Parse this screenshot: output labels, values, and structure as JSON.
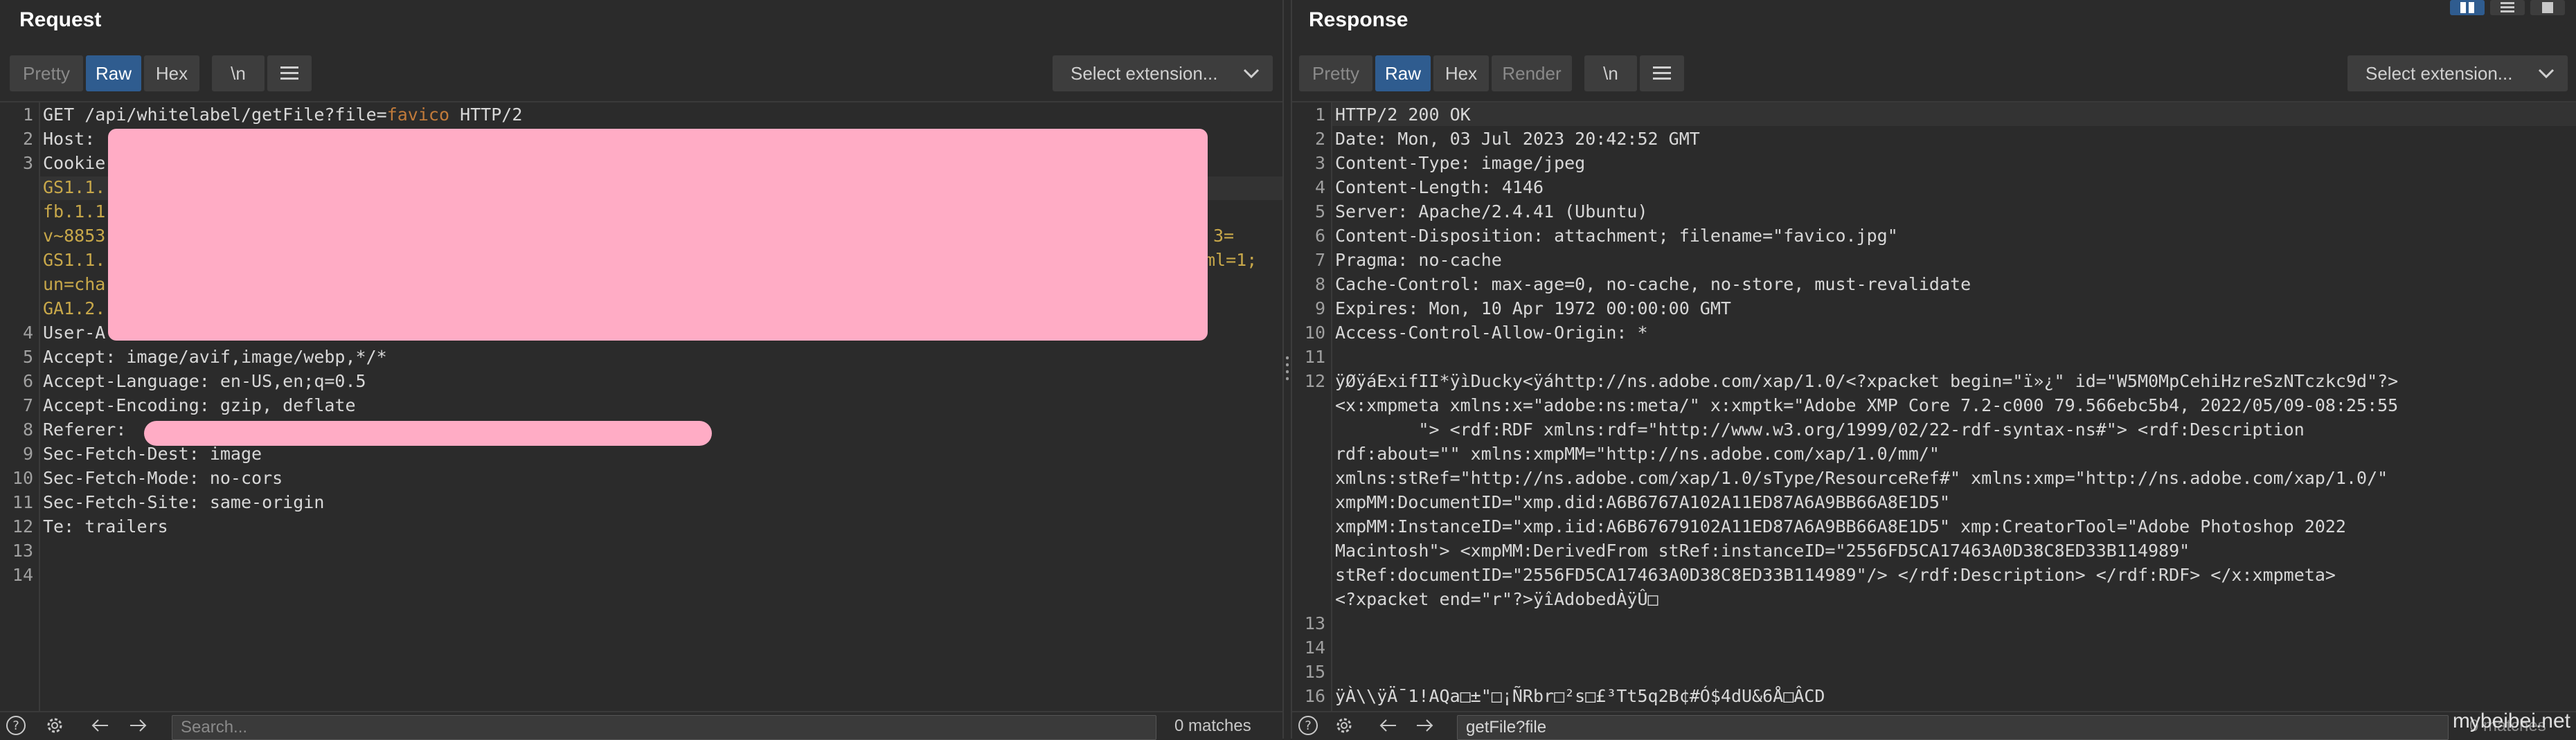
{
  "request": {
    "title": "Request",
    "view_tabs": [
      "Pretty",
      "Raw",
      "Hex",
      "\\n"
    ],
    "menu_icon": "hamburger-icon",
    "select_extension": "Select extension...",
    "lines": {
      "l1_method": "GET /api/whitelabel/getFile?file=",
      "l1_param": "favico",
      "l1_proto": " HTTP/2",
      "l2": "Host: ",
      "l3": "Cookie",
      "l3a": "GS1.1.",
      "l3b": "fb.1.1",
      "l3c": "v~8853",
      "l3c_tail": "3=",
      "l3d": "GS1.1.",
      "l3d_tail": "ml=1;",
      "l3e": "un=cha",
      "l3f": "GA1.2.",
      "l4": "User-A",
      "l5": "Accept: image/avif,image/webp,*/*",
      "l6": "Accept-Language: en-US,en;q=0.5",
      "l7": "Accept-Encoding: gzip, deflate",
      "l8": "Referer: ",
      "l9": "Sec-Fetch-Dest: image",
      "l10": "Sec-Fetch-Mode: no-cors",
      "l11": "Sec-Fetch-Site: same-origin",
      "l12": "Te: trailers",
      "l13": "",
      "l14": ""
    },
    "line_numbers": [
      "1",
      "2",
      "3",
      "4",
      "5",
      "6",
      "7",
      "8",
      "9",
      "10",
      "11",
      "12",
      "13",
      "14"
    ],
    "search_placeholder": "Search...",
    "matches": "0 matches"
  },
  "response": {
    "title": "Response",
    "view_tabs": [
      "Pretty",
      "Raw",
      "Hex",
      "Render",
      "\\n"
    ],
    "menu_icon": "hamburger-icon",
    "select_extension": "Select extension...",
    "lines": {
      "l1": "HTTP/2 200 OK",
      "l2": "Date: Mon, 03 Jul 2023 20:42:52 GMT",
      "l3": "Content-Type: image/jpeg",
      "l4": "Content-Length: 4146",
      "l5": "Server: Apache/2.4.41 (Ubuntu)",
      "l6": "Content-Disposition: attachment; filename=\"favico.jpg\"",
      "l7": "Pragma: no-cache",
      "l8": "Cache-Control: max-age=0, no-cache, no-store, must-revalidate",
      "l9": "Expires: Mon, 10 Apr 1972 00:00:00 GMT",
      "l10": "Access-Control-Allow-Origin: *",
      "l11": "",
      "l12a": "ÿØÿáExifII*ÿìDucky<ÿáhttp://ns.adobe.com/xap/1.0/<?xpacket begin=\"ï»¿\" id=\"W5M0MpCehiHzreSzNTczkc9d\"?>",
      "l12b": "<x:xmpmeta xmlns:x=\"adobe:ns:meta/\" x:xmptk=\"Adobe XMP Core 7.2-c000 79.566ebc5b4, 2022/05/09-08:25:55",
      "l12c": "        \"> <rdf:RDF xmlns:rdf=\"http://www.w3.org/1999/02/22-rdf-syntax-ns#\"> <rdf:Description",
      "l12d": "rdf:about=\"\" xmlns:xmpMM=\"http://ns.adobe.com/xap/1.0/mm/\"",
      "l12e": "xmlns:stRef=\"http://ns.adobe.com/xap/1.0/sType/ResourceRef#\" xmlns:xmp=\"http://ns.adobe.com/xap/1.0/\"",
      "l12f": "xmpMM:DocumentID=\"xmp.did:A6B6767A102A11ED87A6A9BB66A8E1D5\"",
      "l12g": "xmpMM:InstanceID=\"xmp.iid:A6B67679102A11ED87A6A9BB66A8E1D5\" xmp:CreatorTool=\"Adobe Photoshop 2022",
      "l12h": "Macintosh\"> <xmpMM:DerivedFrom stRef:instanceID=\"2556FD5CA17463A0D38C8ED33B114989\"",
      "l12i": "stRef:documentID=\"2556FD5CA17463A0D38C8ED33B114989\"/> </rdf:Description> </rdf:RDF> </x:xmpmeta>",
      "l12j": "<?xpacket end=\"r\"?>ÿîAdobedÀÿÛ□",
      "l13": "",
      "l14": "",
      "l15": "",
      "l16": "ÿÀ\\\\ÿÄ¯1!AQa□±\"□¡ÑRbr□²s□£³Tt5q2B¢#Ó$4dU&6Å□ÂCD"
    },
    "line_numbers": [
      "1",
      "2",
      "3",
      "4",
      "5",
      "6",
      "7",
      "8",
      "9",
      "10",
      "11",
      "12",
      "13",
      "14",
      "15",
      "16"
    ],
    "search_value": "getFile?file",
    "matches": "0 matches"
  },
  "watermark": "mybeibei.net",
  "colors": {
    "background": "#2b2b2b",
    "active_tab": "#2f5c8f",
    "redaction": "#ffacc5",
    "cookie_text": "#c8a84a",
    "param_text": "#c07a3a"
  }
}
